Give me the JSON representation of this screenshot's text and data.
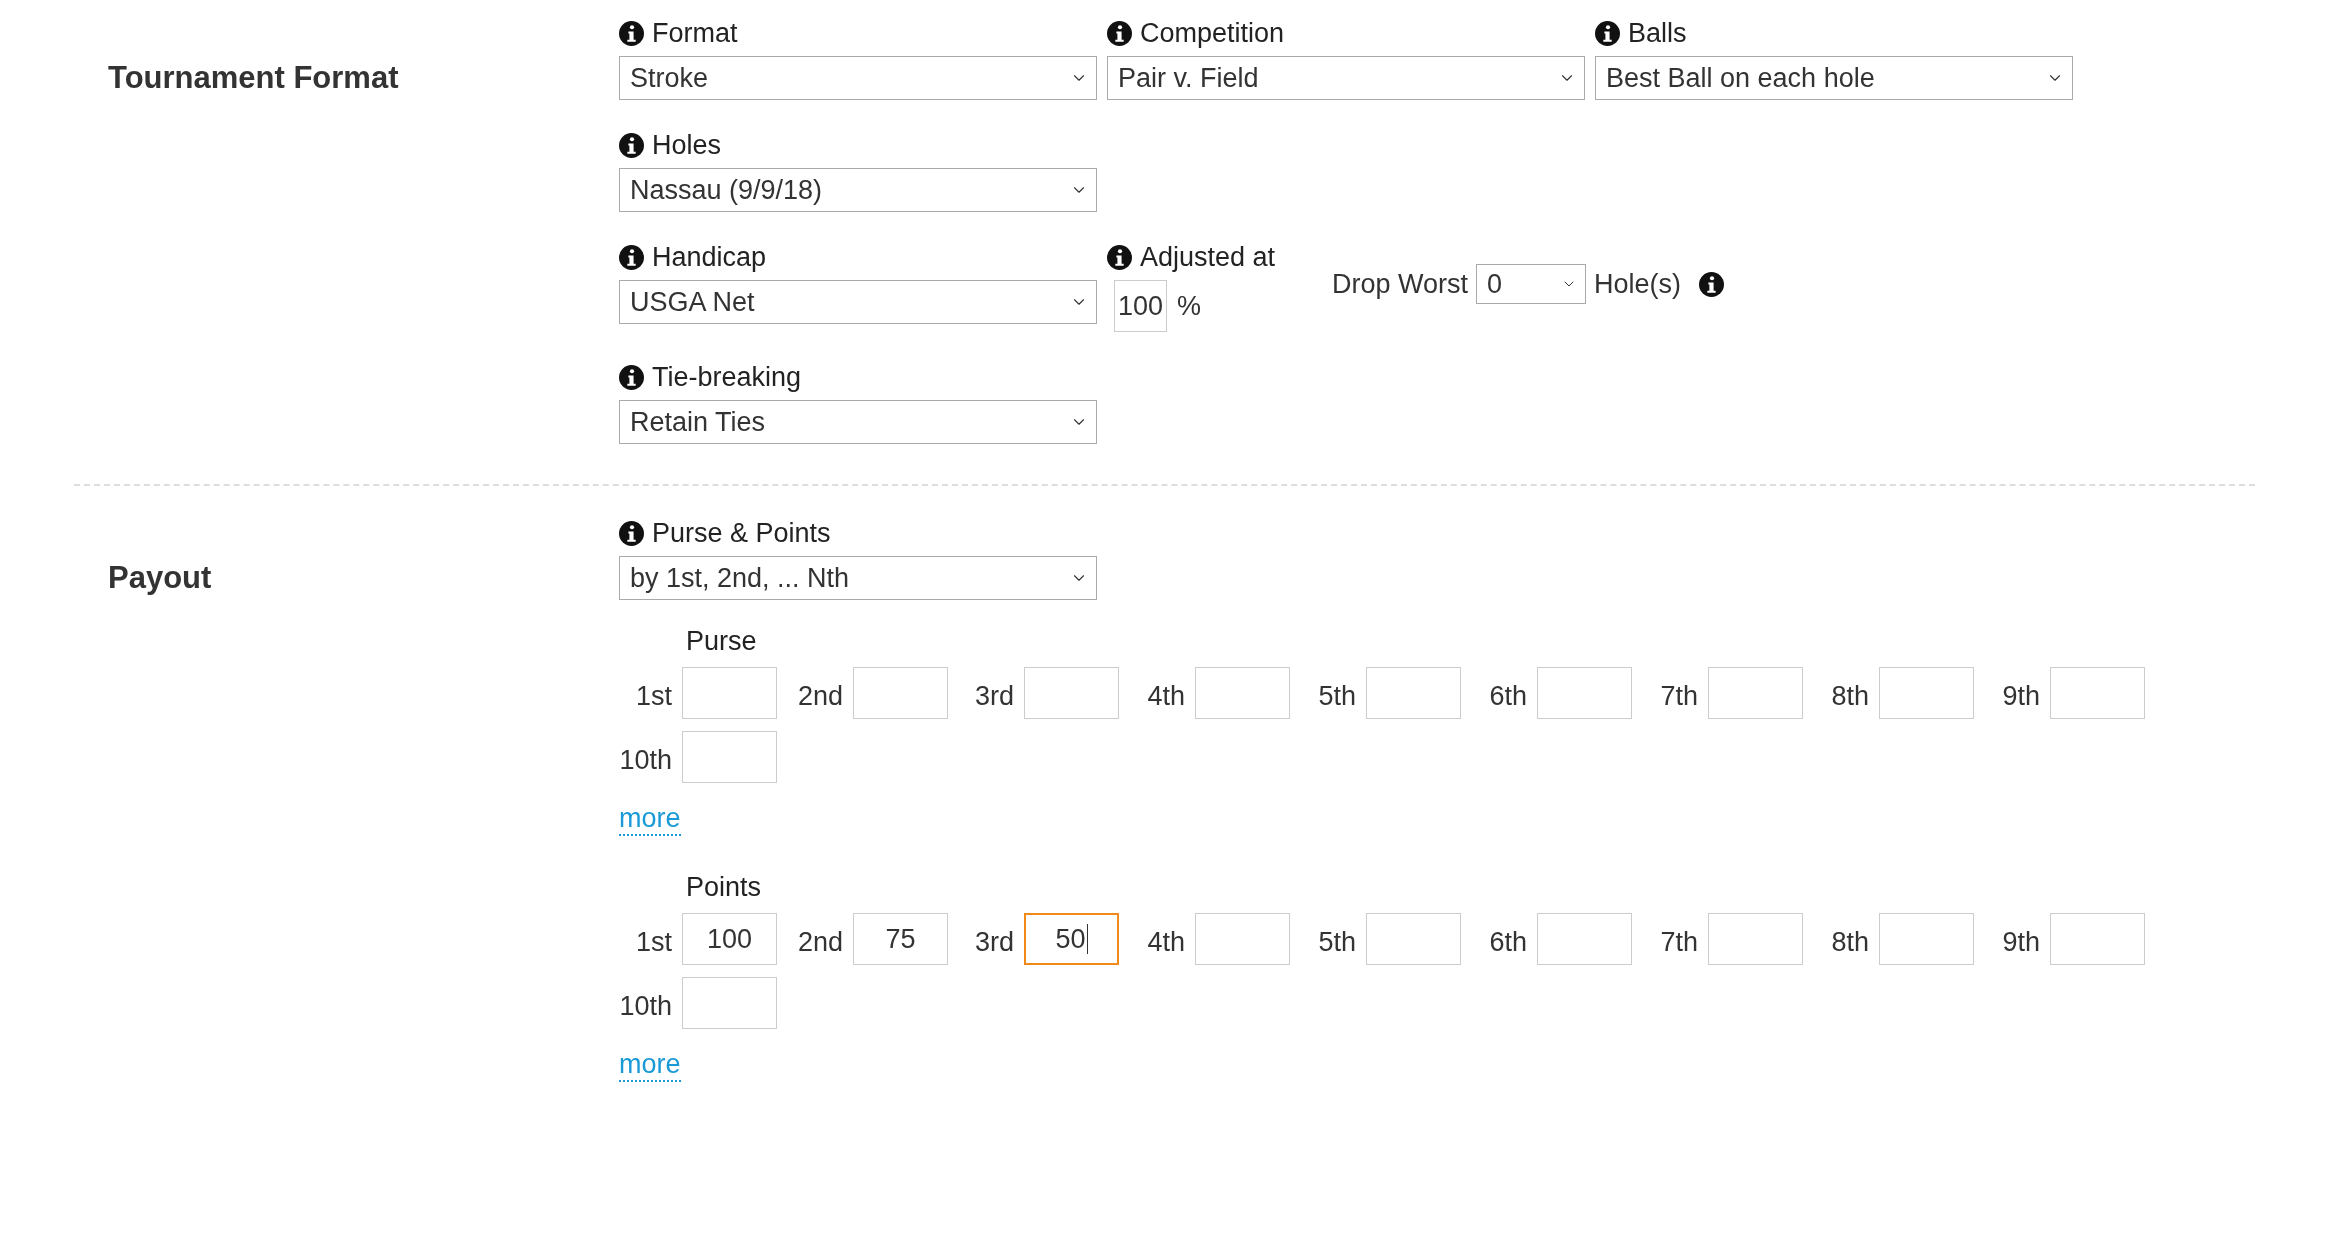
{
  "tournament_format": {
    "title": "Tournament Format",
    "rows": [
      [
        {
          "kind": "select",
          "label": "Format",
          "value": "Stroke"
        },
        {
          "kind": "select",
          "label": "Competition",
          "value": "Pair v. Field"
        },
        {
          "kind": "select",
          "label": "Balls",
          "value": "Best Ball on each hole"
        }
      ],
      [
        {
          "kind": "select",
          "label": "Holes",
          "value": "Nassau (9/9/18)"
        }
      ],
      [
        {
          "kind": "select",
          "label": "Handicap",
          "value": "USGA Net"
        },
        {
          "kind": "percent",
          "label": "Adjusted at",
          "value": "100",
          "unit": "%"
        },
        {
          "kind": "drop",
          "label": "Drop Worst",
          "value": "0",
          "suffix": "Hole(s)"
        }
      ],
      [
        {
          "kind": "select",
          "label": "Tie-breaking",
          "value": "Retain Ties"
        }
      ]
    ]
  },
  "payout": {
    "title": "Payout",
    "select": {
      "label": "Purse & Points",
      "value": "by 1st, 2nd, ... Nth"
    },
    "groups": [
      {
        "title": "Purse",
        "more": "more",
        "places": [
          {
            "label": "1st",
            "focused": false
          },
          {
            "label": "2nd",
            "focused": false
          },
          {
            "label": "3rd",
            "focused": false
          },
          {
            "label": "4th",
            "focused": false
          },
          {
            "label": "5th",
            "focused": false
          },
          {
            "label": "6th",
            "focused": false
          },
          {
            "label": "7th",
            "focused": false
          },
          {
            "label": "8th",
            "focused": false
          },
          {
            "label": "9th",
            "focused": false
          },
          {
            "label": "10th",
            "focused": false
          }
        ]
      },
      {
        "title": "Points",
        "more": "more",
        "places": [
          {
            "label": "1st",
            "value": "100",
            "focused": false
          },
          {
            "label": "2nd",
            "value": "75",
            "focused": false
          },
          {
            "label": "3rd",
            "value": "50",
            "focused": true
          },
          {
            "label": "4th",
            "focused": false
          },
          {
            "label": "5th",
            "focused": false
          },
          {
            "label": "6th",
            "focused": false
          },
          {
            "label": "7th",
            "focused": false
          },
          {
            "label": "8th",
            "focused": false
          },
          {
            "label": "9th",
            "focused": false
          },
          {
            "label": "10th",
            "focused": false
          }
        ]
      }
    ]
  }
}
